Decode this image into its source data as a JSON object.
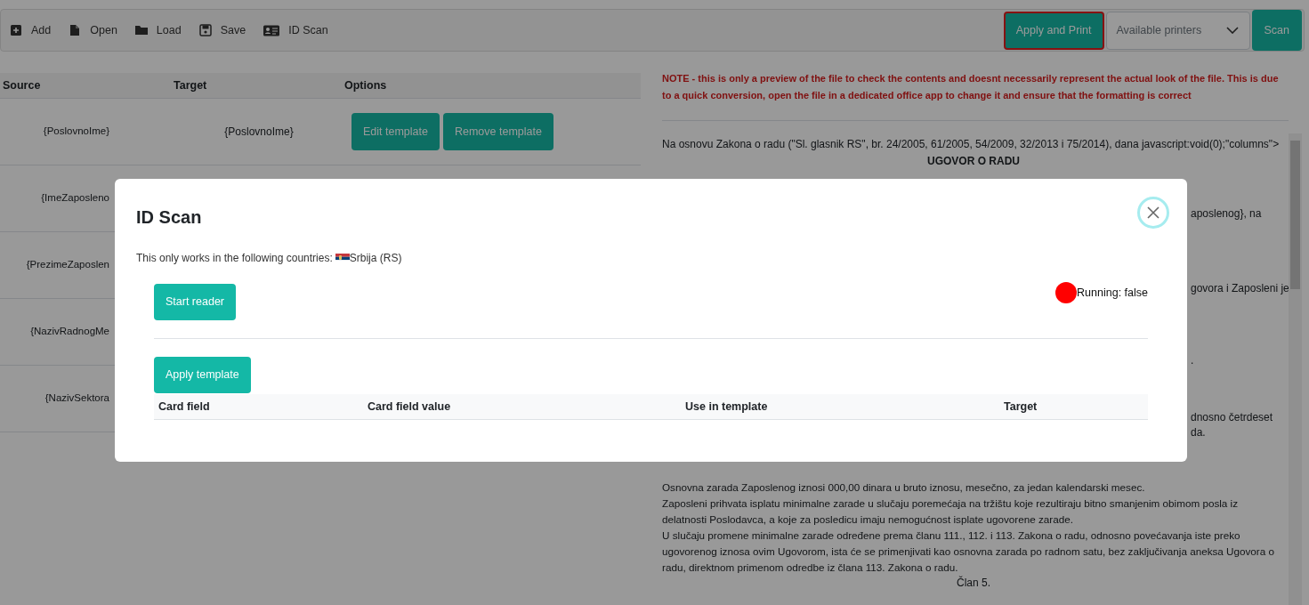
{
  "toolbar": {
    "items": [
      {
        "kind": "add",
        "label": "Add"
      },
      {
        "kind": "open",
        "label": "Open"
      },
      {
        "kind": "load",
        "label": "Load"
      },
      {
        "kind": "save",
        "label": "Save"
      },
      {
        "kind": "idscan",
        "label": "ID Scan"
      }
    ],
    "apply_button": "Apply and Print",
    "printer_select": {
      "placeholder": "Available printers"
    },
    "scan_button": "Scan"
  },
  "mapping_table": {
    "columns": [
      "Source",
      "Target",
      "Options"
    ],
    "rows": [
      {
        "source": "{PoslovnoIme}",
        "target": "{PoslovnoIme}",
        "actions": [
          "Edit template",
          "Remove template"
        ]
      },
      {
        "source": "{ImeZaposleno"
      },
      {
        "source": "{PrezimeZaposlen"
      },
      {
        "source": "{NazivRadnogMe"
      },
      {
        "source": "{NazivSektora"
      }
    ]
  },
  "preview": {
    "note": "NOTE - this is only a preview of the file to check the contents and doesnt necessarily represent the actual look of the file. This is due to a quick conversion, open the file in a dedicated office app to change it and ensure that the formatting is correct",
    "first_line": "Na osnovu Zakona o radu (\"Sl. glasnik RS\", br. 24/2005, 61/2005, 54/2009, 32/2013 i 75/2014), dana javascript:void(0);\"columns\">",
    "heading": "UGOVOR O RADU",
    "fragments": [
      "aposlenog}, na",
      "govora i Zaposleni je",
      ".",
      "dnosno četrdeset",
      "da."
    ],
    "lines": [
      "Osnovna zarada Zaposlenog iznosi 000,00 dinara u bruto iznosu, mesečno, za jedan kalendarski mesec.",
      "Zaposleni prihvata isplatu minimalne zarade u slučaju poremećaja na tržištu koje rezultiraju bitno smanjenim obimom posla iz",
      "delatnosti Poslodavca, a koje za posledicu imaju nemogućnost isplate ugovorene zarade.",
      "U slučaju promene minimalne zarade određene prema članu 111., 112. i 113. Zakona o radu, odnosno povećavanja iste preko",
      "ugovorenog iznosa ovim Ugovorom, ista će se primenjivati kao osnovna zarada po radnom satu, bez zaključivanja aneksa Ugovora o",
      "radu, direktnom primenom odredbe iz člana 113. Zakona o radu."
    ],
    "article": "Član 5."
  },
  "modal": {
    "title": "ID Scan",
    "countries_label": "This only works in the following countries:",
    "country": "Srbija (RS)",
    "start_button": "Start reader",
    "status": {
      "running": false,
      "label": "Running: false"
    },
    "apply_button": "Apply template",
    "columns": [
      "Card field",
      "Card field value",
      "Use in template",
      "Target"
    ]
  }
}
